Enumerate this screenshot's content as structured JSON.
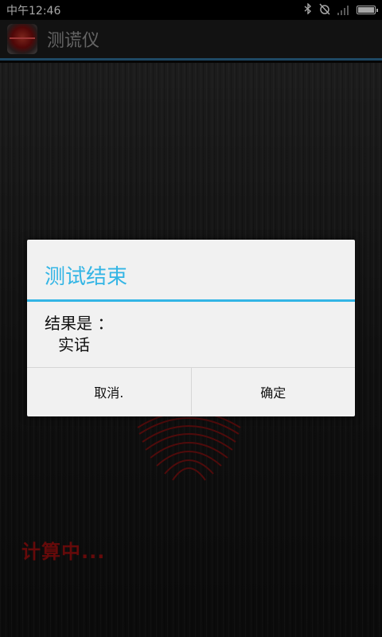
{
  "status_bar": {
    "time": "中午12:46"
  },
  "action_bar": {
    "title": "测谎仪"
  },
  "content": {
    "calc_text": "计算中..."
  },
  "dialog": {
    "title": "测试结束",
    "message_line1": "结果是 ：",
    "message_line2": "实话",
    "cancel_label": "取消.",
    "ok_label": "确定"
  },
  "colors": {
    "accent": "#33b5e5",
    "calc_text": "#9c1010",
    "action_bar_divider": "#2e6f9a"
  }
}
